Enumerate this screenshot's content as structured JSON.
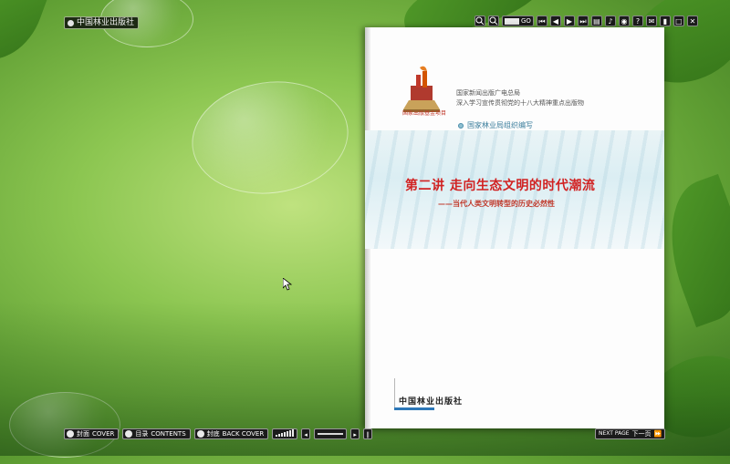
{
  "brand": {
    "label": "中国林业出版社"
  },
  "toolbar": {
    "go_label": "GO"
  },
  "book": {
    "logo_caption": "国家出版基金项目",
    "publisher_line1": "国家新闻出版广电总局",
    "publisher_line2": "深入学习宣传贯彻党的十八大精神重点出版物",
    "organizer": "国家林业局组织编写",
    "title": "第二讲 走向生态文明的时代潮流",
    "subtitle": "——当代人类文明转型的历史必然性",
    "publisher_bottom": "中国林业出版社"
  },
  "nav": {
    "cover_cn": "封面",
    "cover_en": "COVER",
    "contents_cn": "目录",
    "contents_en": "CONTENTS",
    "back_cn": "封底",
    "back_en": "BACK COVER",
    "next_en": "NEXT PAGE",
    "next_cn": "下一页"
  },
  "colors": {
    "title_red": "#d12222",
    "org_blue": "#3a7d9c",
    "bar_blue": "#2c77b8"
  }
}
